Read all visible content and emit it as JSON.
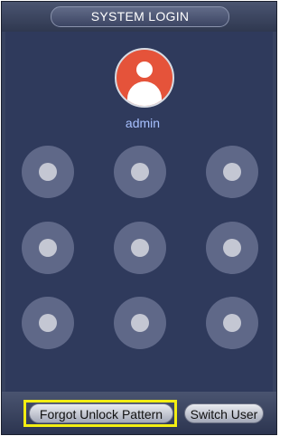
{
  "window": {
    "title": "SYSTEM LOGIN"
  },
  "user": {
    "name": "admin",
    "avatar_icon": "user-avatar-icon",
    "avatar_color": "#e5533a"
  },
  "pattern": {
    "dots": [
      {
        "id": "1"
      },
      {
        "id": "2"
      },
      {
        "id": "3"
      },
      {
        "id": "4"
      },
      {
        "id": "5"
      },
      {
        "id": "6"
      },
      {
        "id": "7"
      },
      {
        "id": "8"
      },
      {
        "id": "9"
      }
    ]
  },
  "footer": {
    "forgot_label": "Forgot Unlock Pattern",
    "switch_label": "Switch User",
    "highlight_color": "#f3ee12"
  }
}
